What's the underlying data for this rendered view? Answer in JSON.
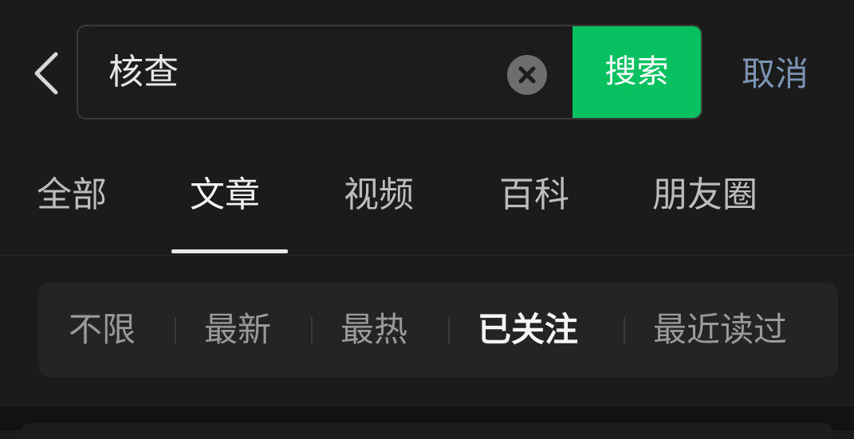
{
  "search": {
    "query": "核查",
    "submit_label": "搜索",
    "cancel_label": "取消"
  },
  "tabs": [
    {
      "label": "全部"
    },
    {
      "label": "文章"
    },
    {
      "label": "视频"
    },
    {
      "label": "百科"
    },
    {
      "label": "朋友圈"
    }
  ],
  "active_tab": "文章",
  "filters": [
    {
      "label": "不限"
    },
    {
      "label": "最新"
    },
    {
      "label": "最热"
    },
    {
      "label": "已关注"
    },
    {
      "label": "最近读过"
    }
  ],
  "active_filter": "已关注",
  "icons": {
    "back": "chevron-left-icon",
    "clear": "close-circle-icon"
  },
  "colors": {
    "background": "#1b1b1b",
    "accent": "#07c160",
    "link": "#7d93b3"
  }
}
